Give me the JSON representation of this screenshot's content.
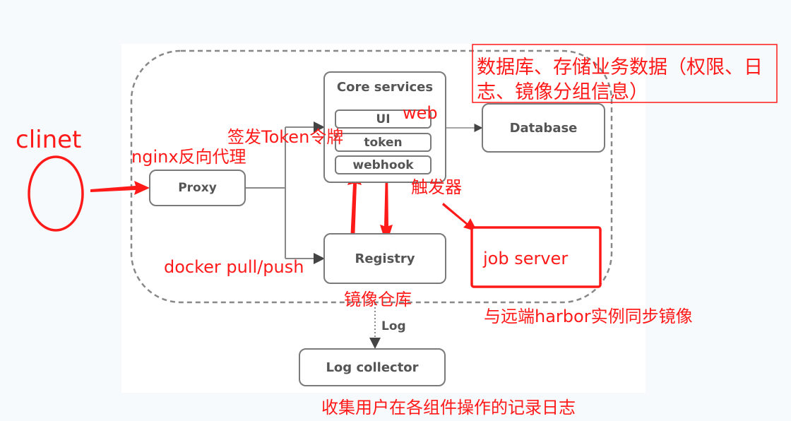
{
  "diagram": {
    "components": {
      "proxy": "Proxy",
      "core_services": "Core services",
      "ui": "UI",
      "token": "token",
      "webhook": "webhook",
      "database": "Database",
      "registry": "Registry",
      "log_collector": "Log collector",
      "job_server": "job server"
    },
    "edge_labels": {
      "log": "Log"
    },
    "annotations": {
      "client": "clinet",
      "nginx": "nginx反向代理",
      "token_issue": "签发Token令牌",
      "web": "web",
      "trigger": "触发器",
      "docker": "docker pull/push",
      "registry_cn": "镜像仓库",
      "database_note_line1": "数据库、存储业务数据（权限、日",
      "database_note_line2": "志、镜像分组信息）",
      "sync": "与远端harbor实例同步镜像",
      "log_note": "收集用户在各组件操作的记录日志"
    },
    "colors": {
      "annotation": "#ff1a1a",
      "component_border": "#7a7a7a",
      "component_text": "#555555"
    }
  }
}
